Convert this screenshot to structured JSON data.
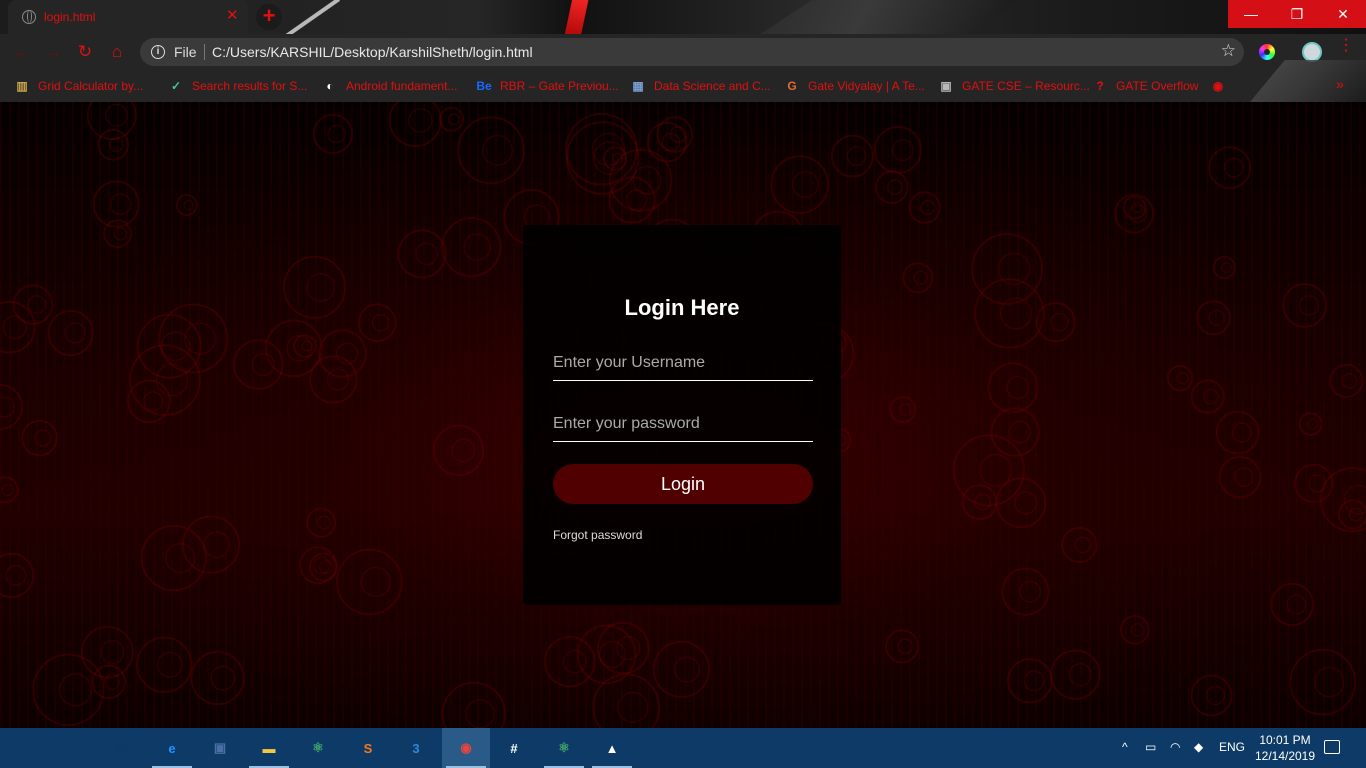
{
  "browser": {
    "tab": {
      "title": "login.html",
      "close_glyph": "✕",
      "icon": "globe-icon"
    },
    "new_tab_glyph": "+",
    "window_controls": {
      "minimize": "—",
      "maximize": "❐",
      "close": "✕"
    },
    "toolbar": {
      "back_glyph": "←",
      "forward_glyph": "→",
      "reload_glyph": "↻",
      "home_glyph": "⌂",
      "info_glyph": "i",
      "scheme_label": "File",
      "url": "C:/Users/KARSHIL/Desktop/KarshilSheth/login.html",
      "star_glyph": "☆",
      "menu_glyph": "⋮"
    },
    "bookmarks": [
      {
        "label": "Grid Calculator by...",
        "icon_glyph": "▥",
        "icon_color": "#c9a24a"
      },
      {
        "label": "Search results for S...",
        "icon_glyph": "✓",
        "icon_color": "#3ec6a0"
      },
      {
        "label": "Android fundament...",
        "icon_glyph": "◐",
        "icon_color": "#ffffff"
      },
      {
        "label": "RBR – Gate Previou...",
        "icon_glyph": "Be",
        "icon_color": "#1769ff"
      },
      {
        "label": "Data Science and C...",
        "icon_glyph": "▦",
        "icon_color": "#7a9bd1"
      },
      {
        "label": "Gate Vidyalay | A Te...",
        "icon_glyph": "G",
        "icon_color": "#e36a2a"
      },
      {
        "label": "GATE CSE – Resourc...",
        "icon_glyph": "▣",
        "icon_color": "#b8b8b8"
      },
      {
        "label": "GATE Overflow",
        "icon_glyph": "?",
        "icon_color": "#e01010"
      }
    ],
    "bookmarks_more_glyph": "»",
    "bookmarks_last_icon_glyph": "◉"
  },
  "login": {
    "heading": "Login Here",
    "username_placeholder": "Enter your Username",
    "password_placeholder": "Enter your password",
    "button_label": "Login",
    "forgot_label": "Forgot password"
  },
  "taskbar": {
    "apps": [
      {
        "name": "start",
        "glyph": "⊞",
        "color": "#0d3a66"
      },
      {
        "name": "task-view",
        "glyph": "❐",
        "color": "#0d3a66"
      },
      {
        "name": "store",
        "glyph": "🛍",
        "color": "#0d3a66"
      },
      {
        "name": "edge",
        "glyph": "e",
        "color": "#1e90ff"
      },
      {
        "name": "virtualbox",
        "glyph": "▣",
        "color": "#4a6fa5"
      },
      {
        "name": "file-explorer",
        "glyph": "▬",
        "color": "#f2c744"
      },
      {
        "name": "atom",
        "glyph": "⚛",
        "color": "#3fa66b"
      },
      {
        "name": "sublime",
        "glyph": "S",
        "color": "#f4781f"
      },
      {
        "name": "css3",
        "glyph": "3",
        "color": "#2a8ad8"
      },
      {
        "name": "chrome",
        "glyph": "◉",
        "color": "#e8453c"
      },
      {
        "name": "slack",
        "glyph": "#",
        "color": "#ffffff"
      },
      {
        "name": "atom-2",
        "glyph": "⚛",
        "color": "#3fa66b"
      },
      {
        "name": "photos",
        "glyph": "▲",
        "color": "#ffffff"
      }
    ],
    "tray": {
      "chevron_glyph": "^",
      "language": "ENG",
      "time": "10:01 PM",
      "date": "12/14/2019"
    }
  }
}
